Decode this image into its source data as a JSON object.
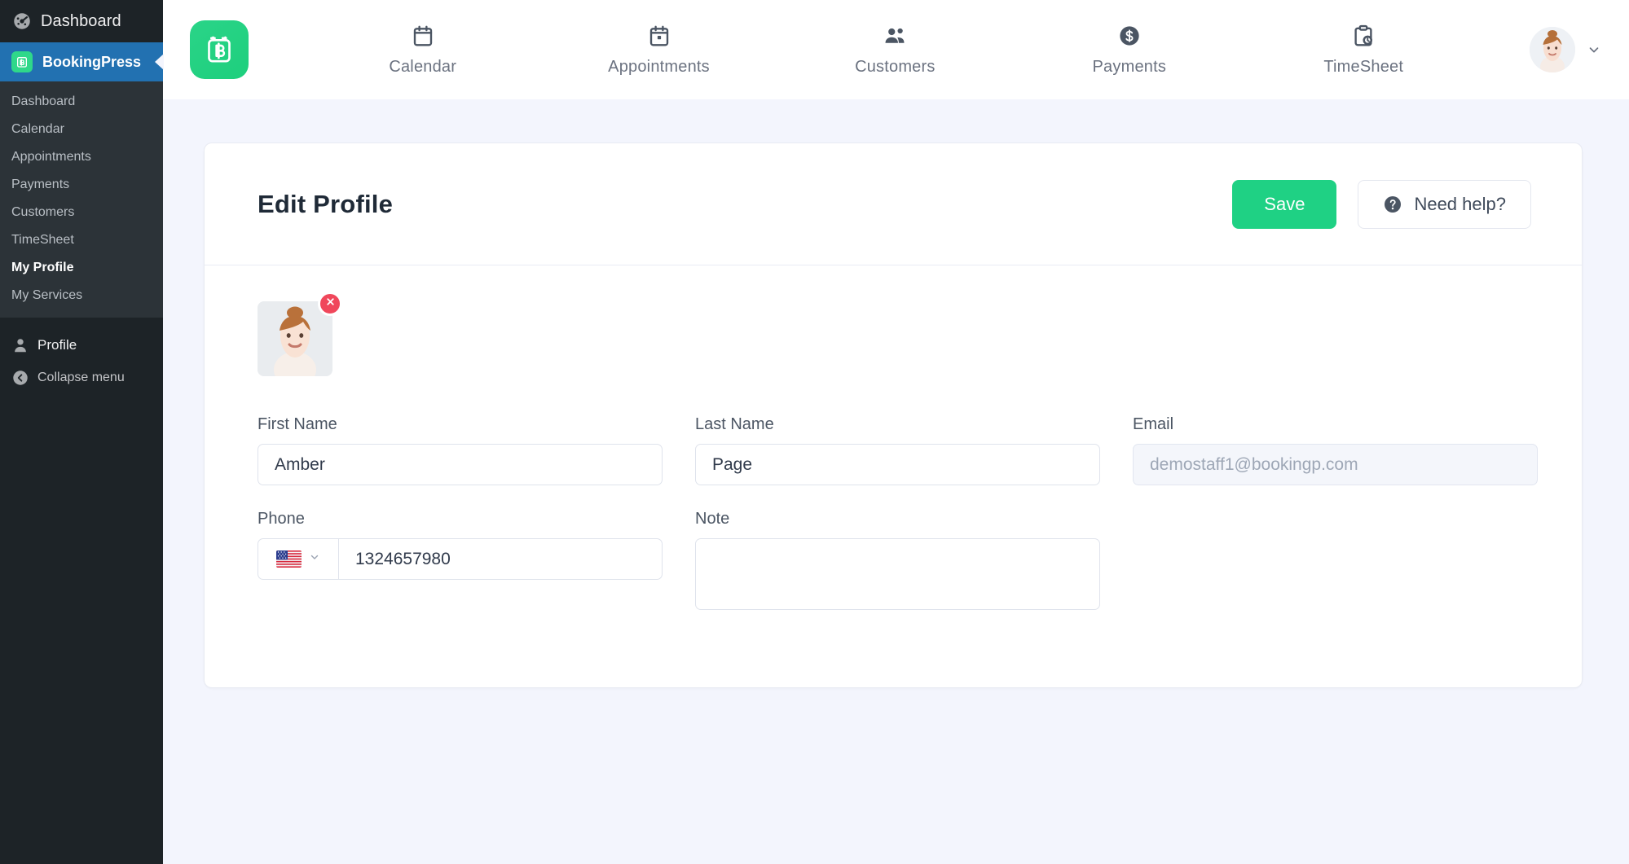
{
  "wp_sidebar": {
    "adminbar": {
      "label": "Dashboard",
      "icon": "gauge-icon"
    },
    "plugin": {
      "label": "BookingPress",
      "icon": "bookingpress-logo-icon",
      "active": true
    },
    "submenu": [
      {
        "label": "Dashboard",
        "current": false
      },
      {
        "label": "Calendar",
        "current": false
      },
      {
        "label": "Appointments",
        "current": false
      },
      {
        "label": "Payments",
        "current": false
      },
      {
        "label": "Customers",
        "current": false
      },
      {
        "label": "TimeSheet",
        "current": false
      },
      {
        "label": "My Profile",
        "current": true
      },
      {
        "label": "My Services",
        "current": false
      }
    ],
    "lower": [
      {
        "label": "Profile",
        "icon": "person-icon"
      },
      {
        "label": "Collapse menu",
        "icon": "collapse-left-icon"
      }
    ],
    "colors": {
      "bg": "#1d2327",
      "submenu_bg": "#2c3338",
      "active": "#2271b1"
    }
  },
  "topnav": {
    "logo_icon": "bookingpress-logo-icon",
    "items": [
      {
        "label": "Calendar",
        "icon": "calendar-icon"
      },
      {
        "label": "Appointments",
        "icon": "appointments-calendar-icon"
      },
      {
        "label": "Customers",
        "icon": "customers-people-icon"
      },
      {
        "label": "Payments",
        "icon": "payments-dollar-icon"
      },
      {
        "label": "TimeSheet",
        "icon": "timesheet-clipboard-clock-icon"
      }
    ],
    "profile": {
      "avatar_icon": "user-avatar",
      "chevron": "chevron-down-icon"
    }
  },
  "card": {
    "title": "Edit Profile",
    "save_label": "Save",
    "help_label": "Need help?",
    "help_icon": "question-circle-icon",
    "save_color": "#1fd184"
  },
  "profile": {
    "avatar_alt": "profile-photo",
    "remove_icon": "close-x-icon",
    "fields": {
      "first_name": {
        "label": "First Name",
        "value": "Amber",
        "placeholder": ""
      },
      "last_name": {
        "label": "Last Name",
        "value": "Page",
        "placeholder": ""
      },
      "email": {
        "label": "Email",
        "value": "",
        "placeholder": "demostaff1@bookingp.com",
        "disabled": true
      },
      "phone": {
        "label": "Phone",
        "value": "1324657980",
        "placeholder": "",
        "country_flag": "us-flag-icon"
      },
      "note": {
        "label": "Note",
        "value": "",
        "placeholder": ""
      }
    }
  }
}
